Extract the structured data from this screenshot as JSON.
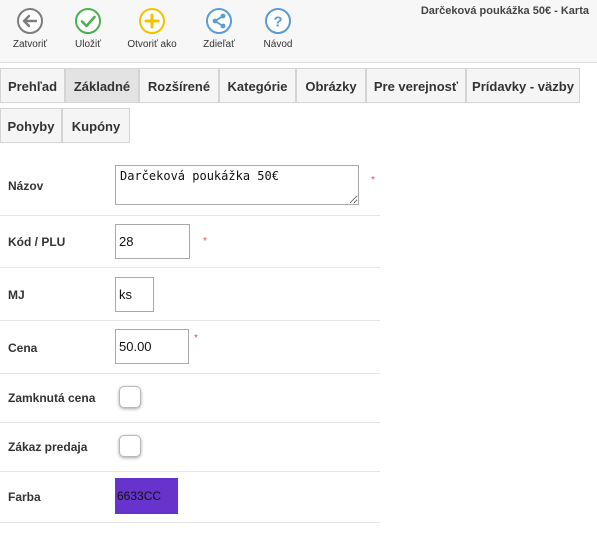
{
  "window": {
    "title": "Darčeková poukážka 50€ - Karta"
  },
  "toolbar": {
    "buttons": [
      {
        "label": "Zatvoriť",
        "icon": "back-arrow-icon",
        "color": "#7d7d7d"
      },
      {
        "label": "Uložiť",
        "icon": "checkmark-icon",
        "color": "#4caf50"
      },
      {
        "label": "Otvoriť ako",
        "icon": "plus-icon",
        "color": "#f2c200"
      },
      {
        "label": "Zdieľať",
        "icon": "share-icon",
        "color": "#5b9bd5"
      },
      {
        "label": "Návod",
        "icon": "help-icon",
        "color": "#5b9bd5"
      }
    ]
  },
  "tabs": [
    {
      "label": "Prehľad",
      "active": false
    },
    {
      "label": "Základné",
      "active": true
    },
    {
      "label": "Rozšírené",
      "active": false
    },
    {
      "label": "Kategórie",
      "active": false
    },
    {
      "label": "Obrázky",
      "active": false
    },
    {
      "label": "Pre verejnosť",
      "active": false
    },
    {
      "label": "Prídavky - väzby",
      "active": false
    },
    {
      "label": "Pohyby",
      "active": false
    },
    {
      "label": "Kupóny",
      "active": false
    }
  ],
  "form": {
    "name": {
      "label": "Názov",
      "value": "Darčeková poukážka 50€",
      "required_mark": "*"
    },
    "code": {
      "label": "Kód / PLU",
      "value": "28",
      "required_mark": "*"
    },
    "unit": {
      "label": "MJ",
      "value": "ks"
    },
    "price": {
      "label": "Cena",
      "value": "50.00",
      "required_mark": "*"
    },
    "locked_price": {
      "label": "Zamknutá cena",
      "checked": false
    },
    "sale_ban": {
      "label": "Zákaz predaja",
      "checked": false
    },
    "color": {
      "label": "Farba",
      "value": "6633CC",
      "hex": "#6633cc"
    }
  }
}
